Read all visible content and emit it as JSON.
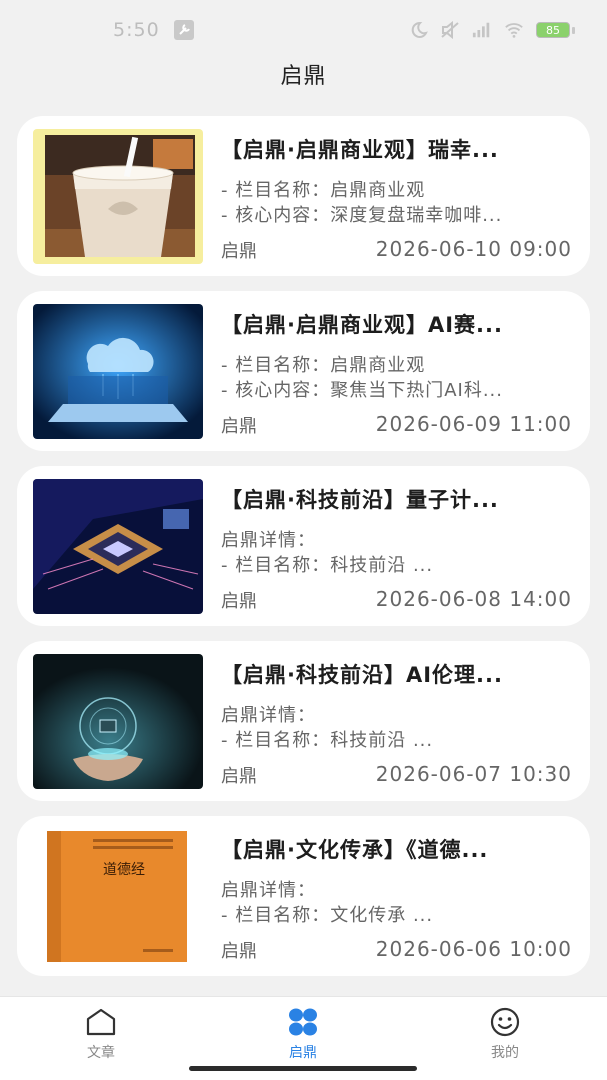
{
  "status_bar": {
    "time": "5:50",
    "battery": "85",
    "icons": [
      "wrench-icon",
      "moon-icon",
      "mute-icon",
      "signal-icon",
      "wifi-icon",
      "battery-icon"
    ]
  },
  "header": {
    "title": "启鼎"
  },
  "articles": [
    {
      "title": "【启鼎·启鼎商业观】瑞幸...",
      "line1": "- 栏目名称：启鼎商业观",
      "line2": "- 核心内容：深度复盘瑞幸咖啡...",
      "source": "启鼎",
      "time": "2026-06-10 09:00",
      "image": "iced-latte-photo"
    },
    {
      "title": "【启鼎·启鼎商业观】AI赛...",
      "line1": "- 栏目名称：启鼎商业观",
      "line2": "- 核心内容：聚焦当下热门AI科...",
      "source": "启鼎",
      "time": "2026-06-09 11:00",
      "image": "cloud-laptop-photo"
    },
    {
      "title": "【启鼎·科技前沿】量子计...",
      "line1": "启鼎详情：",
      "line2": "- 栏目名称：科技前沿 ...",
      "source": "启鼎",
      "time": "2026-06-08 14:00",
      "image": "chip-circuit-photo"
    },
    {
      "title": "【启鼎·科技前沿】AI伦理...",
      "line1": "启鼎详情：",
      "line2": "- 栏目名称：科技前沿 ...",
      "source": "启鼎",
      "time": "2026-06-07 10:30",
      "image": "ai-hand-photo"
    },
    {
      "title": "【启鼎·文化传承】《道德...",
      "line1": "启鼎详情：",
      "line2": "- 栏目名称：文化传承 ...",
      "source": "启鼎",
      "time": "2026-06-06 10:00",
      "image": "daodejing-book-cover",
      "cover_text": "道德经"
    }
  ],
  "tabbar": {
    "tabs": [
      {
        "label": "文章",
        "icon": "home-icon",
        "active": false
      },
      {
        "label": "启鼎",
        "icon": "grid-icon",
        "active": true
      },
      {
        "label": "我的",
        "icon": "smiley-icon",
        "active": false
      }
    ],
    "active_color": "#2a82e4"
  }
}
